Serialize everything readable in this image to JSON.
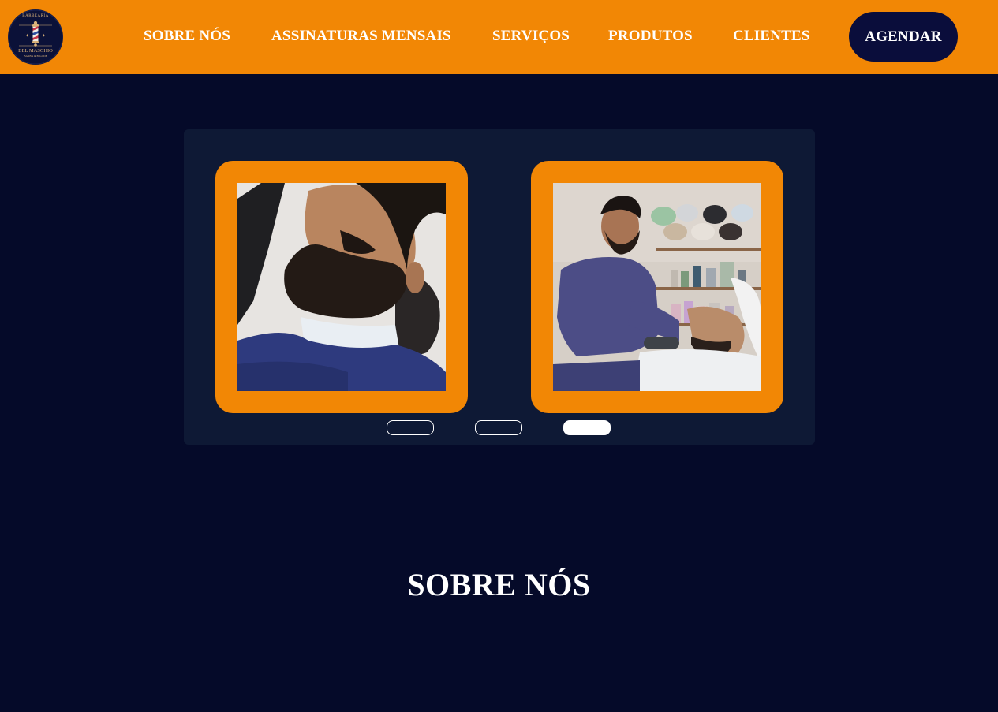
{
  "brand": {
    "logo_top_text": "BARBEARIA",
    "logo_name": "BEL MASCHIO",
    "logo_tagline": "BARBA & BIGODE",
    "primary_color": "#f28705",
    "navy_color": "#0a0d3b",
    "background_color": "#050a29"
  },
  "nav": {
    "items": [
      {
        "label": "SOBRE NÓS"
      },
      {
        "label": "ASSINATURAS MENSAIS"
      },
      {
        "label": "SERVIÇOS"
      },
      {
        "label": "PRODUTOS"
      },
      {
        "label": "CLIENTES"
      }
    ],
    "cta_label": "AGENDAR"
  },
  "carousel": {
    "slides": [
      {
        "image": "bearded-client-reclined-photo"
      },
      {
        "image": "barber-shaving-client-photo"
      }
    ],
    "dots_count": 3,
    "active_dot": 3
  },
  "about": {
    "title": "SOBRE NÓS"
  }
}
